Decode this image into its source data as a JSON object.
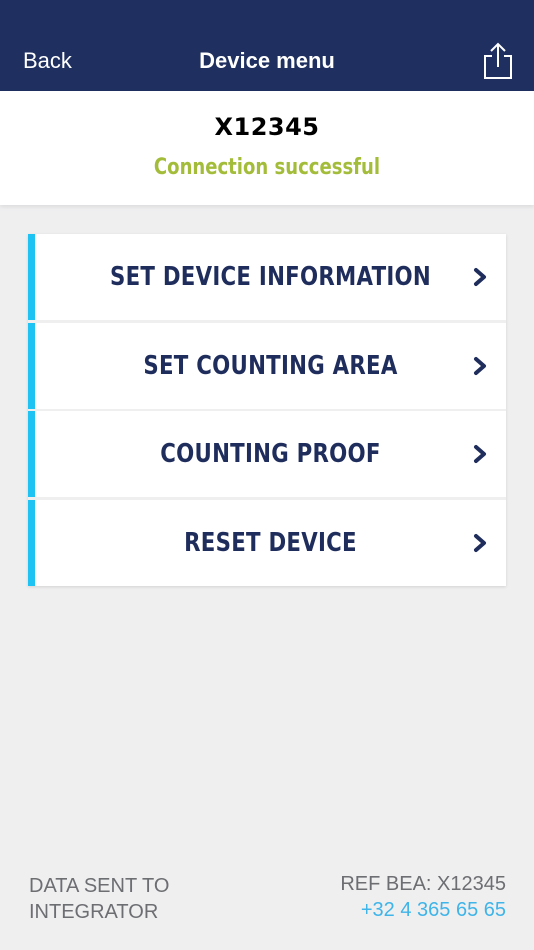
{
  "nav": {
    "back_label": "Back",
    "title": "Device menu",
    "share_icon": "share-icon"
  },
  "device": {
    "id": "X12345",
    "status": "Connection successful"
  },
  "menu": {
    "items": [
      {
        "label": "SET DEVICE INFORMATION"
      },
      {
        "label": "SET COUNTING AREA"
      },
      {
        "label": "COUNTING PROOF"
      },
      {
        "label": "RESET DEVICE"
      }
    ]
  },
  "footer": {
    "data_sent_line1": "DATA SENT TO",
    "data_sent_line2": "INTEGRATOR",
    "ref": "REF BEA: X12345",
    "phone": "+32 4 365 65 65"
  },
  "colors": {
    "navbar": "#1f3060",
    "accent": "#1fc3f3",
    "status_green": "#a3bd3a",
    "menu_text": "#1f2d5c",
    "phone_link": "#3fb4e8"
  }
}
